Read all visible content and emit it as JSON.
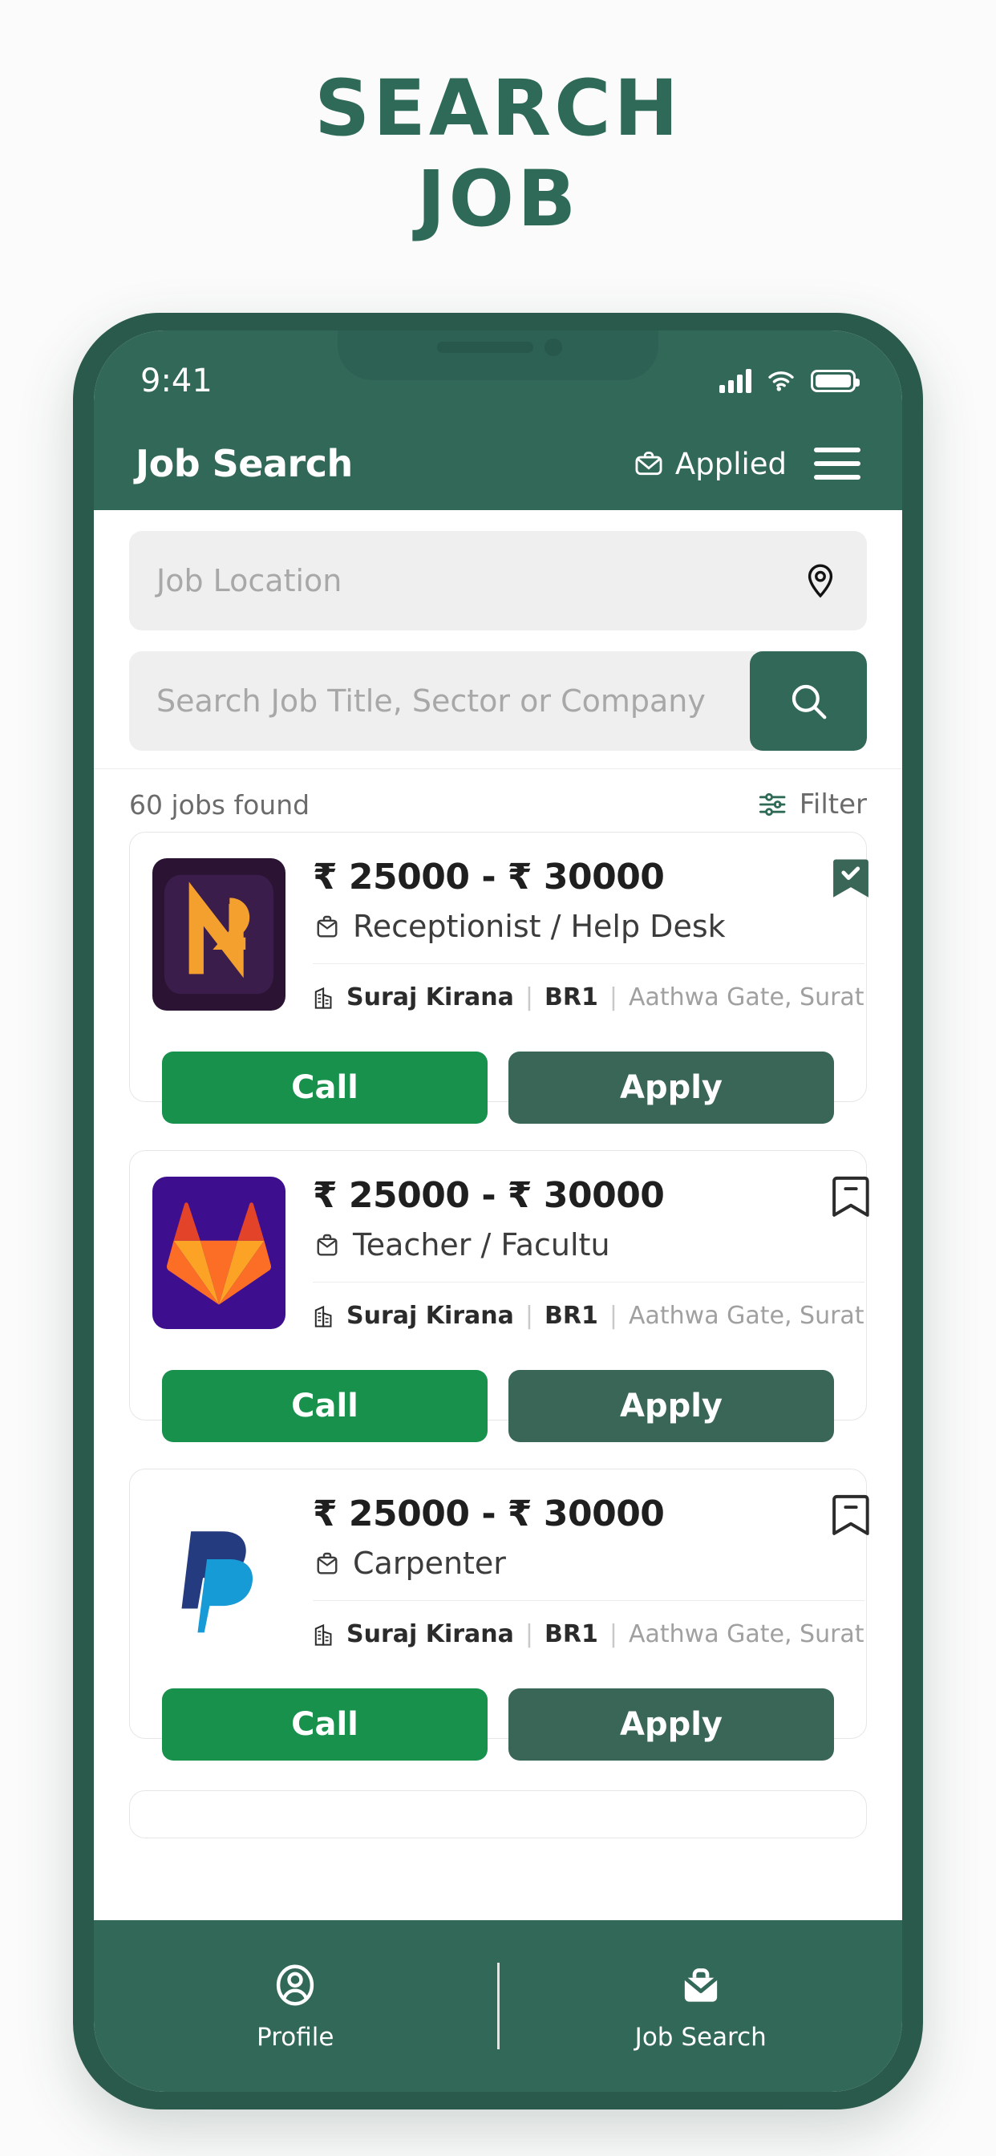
{
  "poster": {
    "line1": "SEARCH",
    "line2": "JOB",
    "accent_color": "#2e6a57"
  },
  "status_bar": {
    "time": "9:41",
    "signal_icon": "cellular-signal-icon",
    "wifi_icon": "wifi-icon",
    "battery_icon": "battery-icon"
  },
  "app_bar": {
    "title": "Job Search",
    "applied_label": "Applied",
    "applied_icon": "briefcase-icon",
    "menu_icon": "hamburger-menu-icon",
    "background": "#326857"
  },
  "search": {
    "location_placeholder": "Job Location",
    "location_icon": "location-pin-icon",
    "query_placeholder": "Search Job Title, Sector or Company",
    "search_icon": "search-icon",
    "search_button_color": "#326857"
  },
  "results": {
    "count_label": "60 jobs found",
    "filter_label": "Filter",
    "filter_icon": "filter-sliders-icon"
  },
  "jobs": [
    {
      "salary": "₹ 25000 - ₹ 30000",
      "role": "Receptionist / Help Desk",
      "role_icon": "briefcase-icon",
      "company": "Suraj Kirana",
      "branch": "BR1",
      "address": "Aathwa Gate, Surat",
      "company_icon": "building-icon",
      "bookmark_icon": "bookmark-checked-icon",
      "bookmarked": "true",
      "logo": "napkin-logo",
      "call_label": "Call",
      "apply_label": "Apply"
    },
    {
      "salary": "₹ 25000 - ₹ 30000",
      "role": "Teacher / Facultu",
      "role_icon": "briefcase-icon",
      "company": "Suraj Kirana",
      "branch": "BR1",
      "address": "Aathwa Gate, Surat",
      "company_icon": "building-icon",
      "bookmark_icon": "bookmark-outline-icon",
      "bookmarked": "false",
      "logo": "gitlab-logo",
      "call_label": "Call",
      "apply_label": "Apply"
    },
    {
      "salary": "₹ 25000 - ₹ 30000",
      "role": "Carpenter",
      "role_icon": "briefcase-icon",
      "company": "Suraj Kirana",
      "branch": "BR1",
      "address": "Aathwa Gate, Surat",
      "company_icon": "building-icon",
      "bookmark_icon": "bookmark-outline-icon",
      "bookmarked": "false",
      "logo": "paypal-logo",
      "call_label": "Call",
      "apply_label": "Apply"
    }
  ],
  "bottom_nav": {
    "items": [
      {
        "label": "Profile",
        "icon": "user-circle-icon"
      },
      {
        "label": "Job Search",
        "icon": "briefcase-filled-icon"
      }
    ]
  },
  "colors": {
    "brand_green": "#326857",
    "call_green": "#17914c",
    "apply_green": "#3a6657",
    "frame_green": "#2a5a4b"
  }
}
